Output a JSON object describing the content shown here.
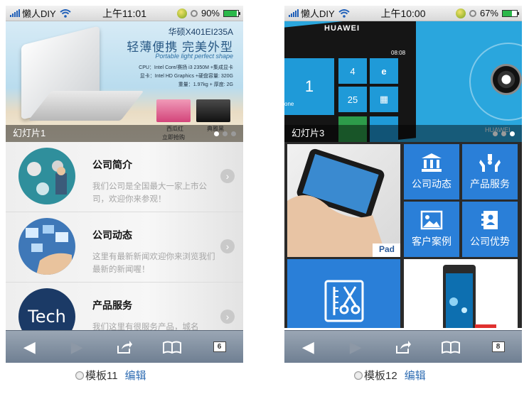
{
  "templates": [
    {
      "status": {
        "carrier": "懒人DIY",
        "time": "上午11:01",
        "battery": "90%",
        "battery_level": 0.9
      },
      "slide": {
        "caption": "幻灯片1",
        "model": "华硕X401EI235A",
        "slogan": "轻薄便携 完美外型",
        "sub": "Portable light perfect shape",
        "spec1": "CPU：Intel Core/赛扬 i3 2350M +集成显卡",
        "spec2": "显卡：Intel HD Graphics +硬盘容量: 320G",
        "spec3": "重量：1.97kg + 厚度: 2G",
        "pink_label": "西瓜红",
        "black_label": "典雅黑",
        "bottom_label": "立即抢购",
        "active_dot": 0
      },
      "list": [
        {
          "title": "公司简介",
          "desc": "我们公司是全国最大一家上市公司，欢迎你来参观！",
          "thumb_text": ""
        },
        {
          "title": "公司动态",
          "desc": "这里有最新新闻欢迎你来浏览我们最新的新闻喔！",
          "thumb_text": ""
        },
        {
          "title": "产品服务",
          "desc": "我们这里有很服务产品，城名",
          "thumb_text": "Tech"
        }
      ],
      "tab_count": "6",
      "caption": "模板11",
      "edit": "编辑"
    },
    {
      "status": {
        "carrier": "懒人DIY",
        "time": "上午10:00",
        "battery": "67%",
        "battery_level": 0.67
      },
      "slide": {
        "caption": "幻灯片3",
        "brand": "HUAWEI",
        "clock": "08:08",
        "logo": "HUAWEI",
        "tile_text": "1",
        "tile_msg": "4",
        "tile_mail": "25",
        "edge_text": "one",
        "active_dot": 2
      },
      "tiles": [
        {
          "label": "公司动态",
          "icon": "bank-icon"
        },
        {
          "label": "产品服务",
          "icon": "service-icon"
        },
        {
          "label": "客户案例",
          "icon": "picture-icon"
        },
        {
          "label": "公司优势",
          "icon": "contacts-icon"
        }
      ],
      "hand_photo_label": "Pad",
      "tab_count": "8",
      "caption": "模板12",
      "edit": "编辑"
    }
  ],
  "colors": {
    "tile_blue": "#2a7fd8",
    "link_blue": "#2f6db3",
    "toolbar": "#7f8ea0"
  }
}
